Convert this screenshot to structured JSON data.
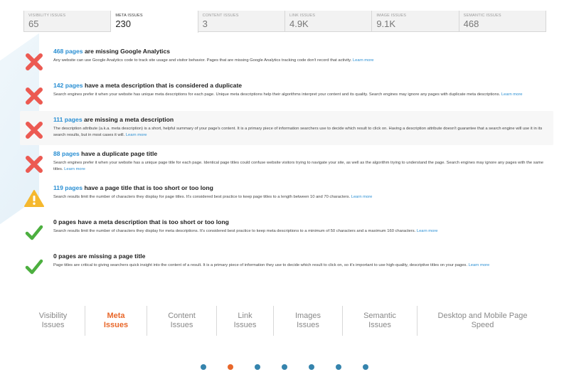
{
  "tabs": [
    {
      "title": "Visibility Issues",
      "value": "65",
      "active": false
    },
    {
      "title": "Meta Issues",
      "value": "230",
      "active": true
    },
    {
      "title": "Content Issues",
      "value": "3",
      "active": false
    },
    {
      "title": "Link Issues",
      "value": "4.9K",
      "active": false
    },
    {
      "title": "Image Issues",
      "value": "9.1K",
      "active": false
    },
    {
      "title": "Semantic Issues",
      "value": "468",
      "active": false
    }
  ],
  "issues": [
    {
      "status": "error",
      "icon": "x-icon",
      "count": "468 pages",
      "title_rest": " are missing Google Analytics",
      "desc": "Any website can use Google Analytics code to track site usage and visitor behavior. Pages that are missing Google Analytics tracking code don't record that activity.",
      "learn": "Learn more"
    },
    {
      "status": "error",
      "icon": "x-icon",
      "count": "142 pages",
      "title_rest": " have a meta description that is considered a duplicate",
      "desc": "Search engines prefer it when your website has unique meta descriptions for each page. Unique meta descriptions help their algorithms interpret your content and its quality. Search engines may ignore any pages with duplicate meta descriptions.",
      "learn": "Learn more"
    },
    {
      "status": "error",
      "icon": "x-icon",
      "count": "111 pages",
      "title_rest": " are missing a meta description",
      "desc": "The description attribute (a.k.a. meta description) is a short, helpful summary of your page's content. It is a primary piece of information searchers use to decide which result to click on. Having a description attribute doesn't guarantee that a search engine will use it in its search results, but in most cases it will.",
      "learn": "Learn more"
    },
    {
      "status": "error",
      "icon": "x-icon",
      "count": "88 pages",
      "title_rest": " have a duplicate page title",
      "desc": "Search engines prefer it when your website has a unique page title for each page. Identical page titles could confuse website visitors trying to navigate your site, as well as the algorithm trying to understand the page. Search engines may ignore any pages with the same titles.",
      "learn": "Learn more"
    },
    {
      "status": "warning",
      "icon": "warning-icon",
      "count": "119 pages",
      "title_rest": " have a page title that is too short or too long",
      "desc": "Search results limit the number of characters they display for page titles. It's considered best practice to keep page titles to a length between 10 and 70 characters.",
      "learn": "Learn more"
    },
    {
      "status": "ok",
      "icon": "check-icon",
      "count": "0 pages",
      "title_rest": " have a meta description that is too short or too long",
      "desc": "Search results limit the number of characters they display for meta descriptions. It's considered best practice to keep meta descriptions to a minimum of 50 characters and a maximum 160 characters.",
      "learn": "Learn more"
    },
    {
      "status": "ok",
      "icon": "check-icon",
      "count": "0 pages",
      "title_rest": " are missing a page title",
      "desc": "Page titles are critical to giving searchers quick insight into the content of a result. It is a primary piece of information they use to decide which result to click on, so it's important to use high-quality, descriptive titles on your pages.",
      "learn": "Learn more"
    }
  ],
  "bottom_nav": [
    {
      "line1": "Visibility",
      "line2": "Issues",
      "active": false
    },
    {
      "line1": "Meta",
      "line2": "Issues",
      "active": true
    },
    {
      "line1": "Content",
      "line2": "Issues",
      "active": false
    },
    {
      "line1": "Link",
      "line2": "Issues",
      "active": false
    },
    {
      "line1": "Images",
      "line2": "Issues",
      "active": false
    },
    {
      "line1": "Semantic",
      "line2": "Issues",
      "active": false
    },
    {
      "line1": "Desktop and Mobile Page",
      "line2": "Speed",
      "active": false
    }
  ],
  "dots": {
    "count": 7,
    "active_index": 1
  },
  "colors": {
    "link": "#2a8fd3",
    "error": "#ec5a52",
    "warning": "#f5b82e",
    "ok": "#4caf3f",
    "accent": "#e8672a",
    "dot": "#3584ad"
  }
}
